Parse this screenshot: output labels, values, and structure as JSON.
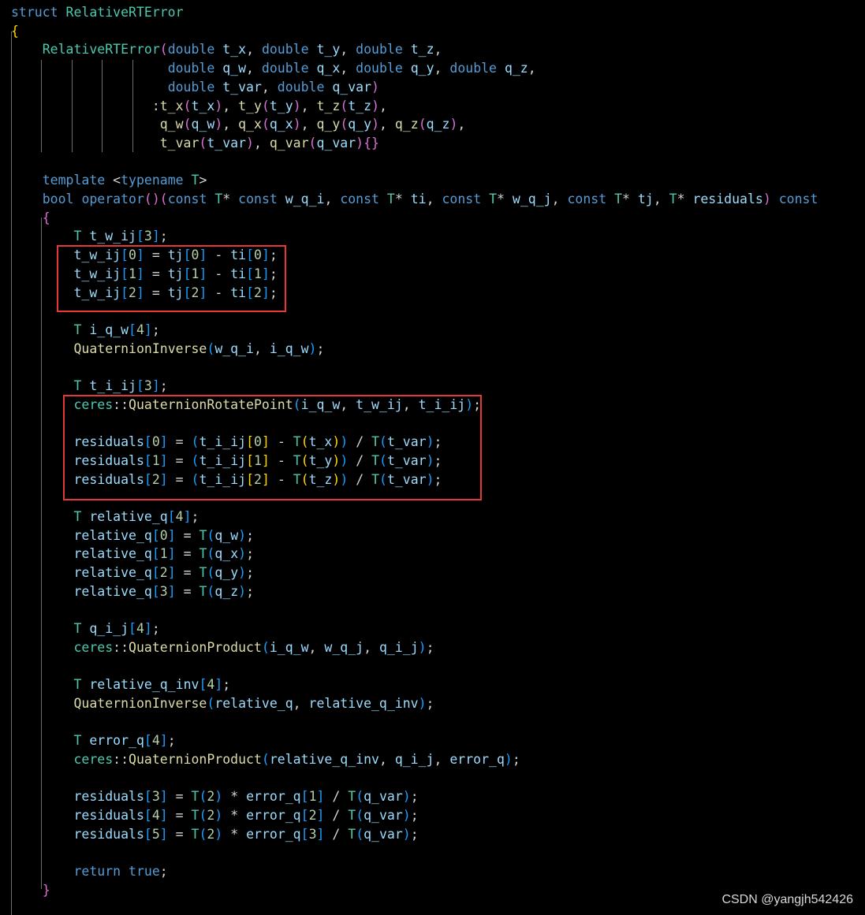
{
  "colors": {
    "background": "#000000",
    "keyword": "#569cd6",
    "type": "#4ec9b0",
    "function": "#dcdcaa",
    "variable": "#9cdcfe",
    "number": "#b5cea8",
    "operator": "#d4d4d4",
    "bracket_gold": "#ffd700",
    "bracket_magenta": "#da70d6",
    "bracket_blue": "#179fff",
    "highlight_box": "#e53935",
    "watermark": "#d9d9d9"
  },
  "watermark": "CSDN @yangjh542426",
  "code_lines": [
    "struct RelativeRTError",
    "{",
    "    RelativeRTError(double t_x, double t_y, double t_z,",
    "                    double q_w, double q_x, double q_y, double q_z,",
    "                    double t_var, double q_var)",
    "                  :t_x(t_x), t_y(t_y), t_z(t_z),",
    "                   q_w(q_w), q_x(q_x), q_y(q_y), q_z(q_z),",
    "                   t_var(t_var), q_var(q_var){}",
    "",
    "    template <typename T>",
    "    bool operator()(const T* const w_q_i, const T* ti, const T* w_q_j, const T* tj, T* residuals) const",
    "    {",
    "        T t_w_ij[3];",
    "        t_w_ij[0] = tj[0] - ti[0];",
    "        t_w_ij[1] = tj[1] - ti[1];",
    "        t_w_ij[2] = tj[2] - ti[2];",
    "",
    "        T i_q_w[4];",
    "        QuaternionInverse(w_q_i, i_q_w);",
    "",
    "        T t_i_ij[3];",
    "        ceres::QuaternionRotatePoint(i_q_w, t_w_ij, t_i_ij);",
    "",
    "        residuals[0] = (t_i_ij[0] - T(t_x)) / T(t_var);",
    "        residuals[1] = (t_i_ij[1] - T(t_y)) / T(t_var);",
    "        residuals[2] = (t_i_ij[2] - T(t_z)) / T(t_var);",
    "",
    "        T relative_q[4];",
    "        relative_q[0] = T(q_w);",
    "        relative_q[1] = T(q_x);",
    "        relative_q[2] = T(q_y);",
    "        relative_q[3] = T(q_z);",
    "",
    "        T q_i_j[4];",
    "        ceres::QuaternionProduct(i_q_w, w_q_j, q_i_j);",
    "",
    "        T relative_q_inv[4];",
    "        QuaternionInverse(relative_q, relative_q_inv);",
    "",
    "        T error_q[4];",
    "        ceres::QuaternionProduct(relative_q_inv, q_i_j, error_q);",
    "",
    "        residuals[3] = T(2) * error_q[1] / T(q_var);",
    "        residuals[4] = T(2) * error_q[2] / T(q_var);",
    "        residuals[5] = T(2) * error_q[3] / T(q_var);",
    "",
    "        return true;",
    "    }"
  ]
}
